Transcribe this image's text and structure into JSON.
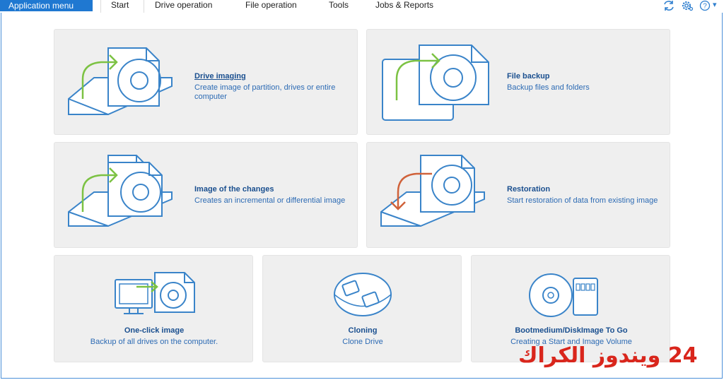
{
  "menubar": {
    "app_menu": "Application menu",
    "items": [
      "Start",
      "Drive operation",
      "File operation",
      "Tools",
      "Jobs & Reports"
    ],
    "icons": [
      "refresh-icon",
      "settings-icon",
      "help-icon"
    ],
    "help_dropdown": "▾"
  },
  "tiles": [
    {
      "title": "Drive imaging",
      "desc": "Create image of partition, drives or entire computer",
      "icon": "drive-imaging-icon"
    },
    {
      "title": "File backup",
      "desc": "Backup files and folders",
      "icon": "file-backup-icon"
    },
    {
      "title": "Image of the changes",
      "desc": "Creates an incremental or differential image",
      "icon": "incremental-image-icon"
    },
    {
      "title": "Restoration",
      "desc": "Start restoration of data from existing image",
      "icon": "restoration-icon"
    },
    {
      "title": "One-click image",
      "desc": "Backup of all drives on the computer.",
      "icon": "one-click-image-icon"
    },
    {
      "title": "Cloning",
      "desc": "Clone Drive",
      "icon": "cloning-icon"
    },
    {
      "title": "Bootmedium/DiskImage To Go",
      "desc": "Creating a Start and Image Volume",
      "icon": "boot-medium-icon"
    }
  ],
  "watermark": "24 ويندوز الكراك",
  "colors": {
    "accent": "#1f78d1",
    "icon_blue": "#3a84c9",
    "green_arrow": "#7cc243",
    "orange_arrow": "#d0623a",
    "tile_bg": "#efefef",
    "watermark": "#d9261c"
  }
}
